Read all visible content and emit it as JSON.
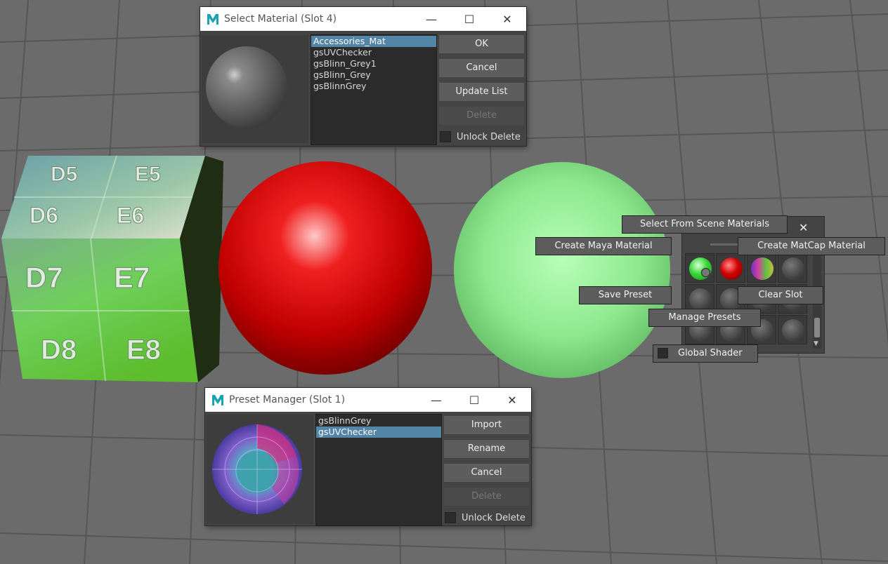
{
  "colors": {
    "grid_bg": "#6a6a6a",
    "window_bg": "#444444",
    "selection": "#5285a6",
    "red_sphere": "#d00000",
    "green_sphere": "#86e38a",
    "maya_logo": "#1aa3b5"
  },
  "cube_labels": [
    "D5",
    "E5",
    "D6",
    "E6",
    "D7",
    "E7",
    "D8",
    "E8"
  ],
  "select_material": {
    "title": "Select Material (Slot 4)",
    "items": [
      "Accessories_Mat",
      "gsUVChecker",
      "gsBlinn_Grey1",
      "gsBlinn_Grey",
      "gsBlinnGrey"
    ],
    "selected_index": 0,
    "buttons": {
      "ok": "OK",
      "cancel": "Cancel",
      "update": "Update List",
      "delete": "Delete"
    },
    "unlock_label": "Unlock Delete"
  },
  "preset_manager": {
    "title": "Preset Manager (Slot 1)",
    "items": [
      "gsBlinnGrey",
      "gsUVChecker"
    ],
    "selected_index": 1,
    "buttons": {
      "import": "Import",
      "rename": "Rename",
      "cancel": "Cancel",
      "delete": "Delete"
    },
    "unlock_label": "Unlock Delete"
  },
  "shader_panel": {
    "tooltips": {
      "scene": "Select From Scene Materials",
      "maya": "Create Maya Material",
      "matcap": "Create MatCap Material",
      "save": "Save Preset",
      "clear": "Clear Slot",
      "manage": "Manage Presets",
      "global": "Global Shader"
    },
    "close_icon": "close-icon",
    "slots": [
      "green",
      "red",
      "uv",
      "grey",
      "grey",
      "grey",
      "grey",
      "grey",
      "grey",
      "grey",
      "grey",
      "grey"
    ]
  },
  "icons": {
    "minimize": "—",
    "maximize": "☐",
    "close": "✕",
    "close_small": "✕"
  }
}
